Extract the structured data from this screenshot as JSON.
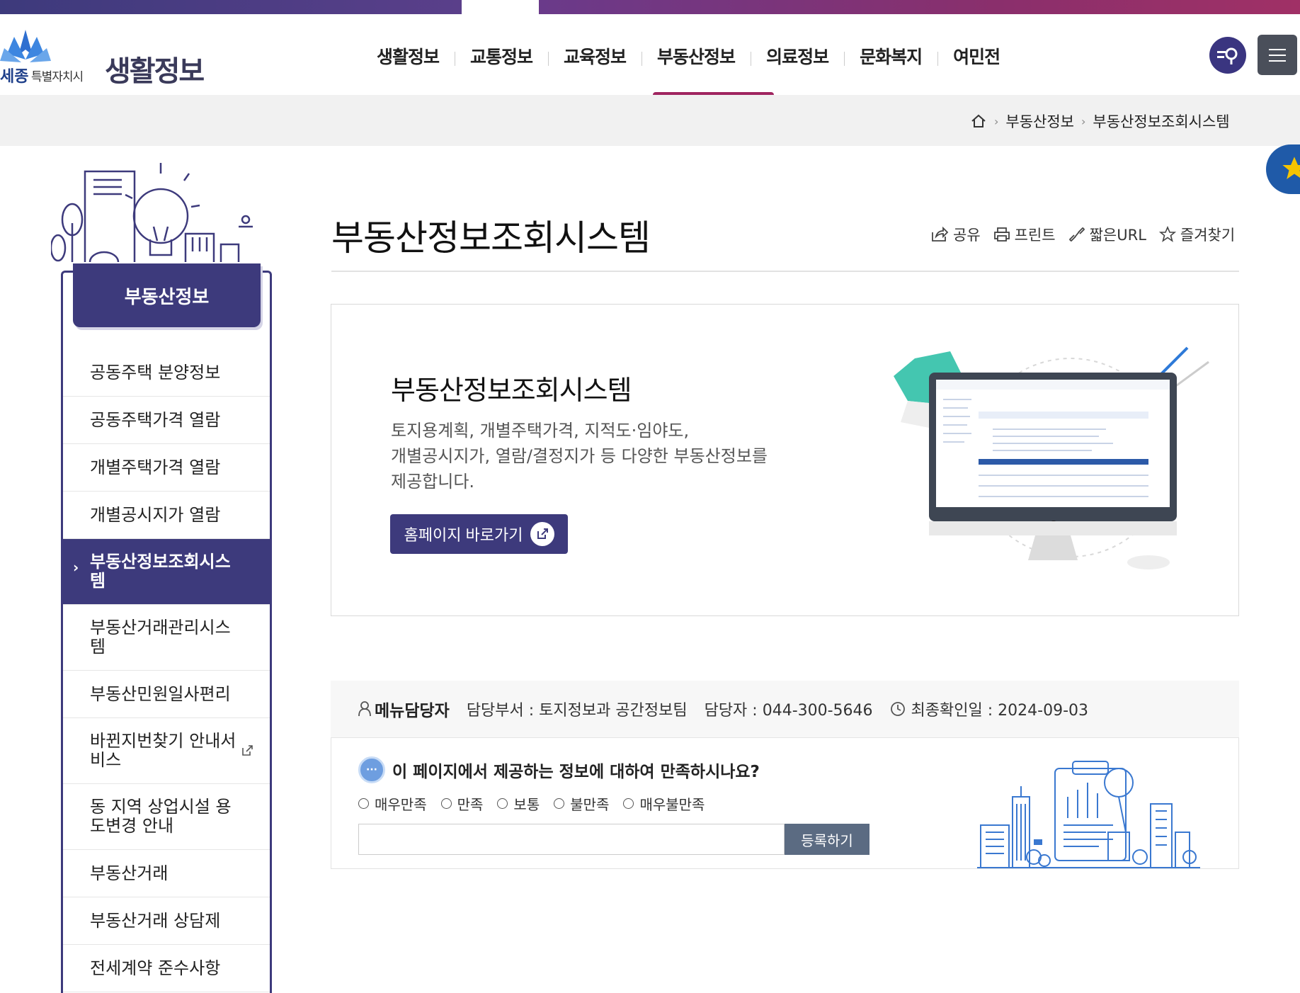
{
  "header": {
    "logo_sejong": "세종",
    "logo_sub": "특별자치시",
    "logo_main": "생활정보",
    "nav": [
      "생활정보",
      "교통정보",
      "교육정보",
      "부동산정보",
      "의료정보",
      "문화복지",
      "여민전"
    ],
    "active_nav": "부동산정보",
    "colors": {
      "primary": "#3d3a7c",
      "accent": "#a02560"
    }
  },
  "breadcrumb": {
    "home_icon": "home-icon",
    "items": [
      "부동산정보",
      "부동산정보조회시스템"
    ]
  },
  "sidebar": {
    "title": "부동산정보",
    "items": [
      {
        "label": "공동주택 분양정보"
      },
      {
        "label": "공동주택가격 열람"
      },
      {
        "label": "개별주택가격 열람"
      },
      {
        "label": "개별공시지가 열람"
      },
      {
        "label": "부동산정보조회시스템",
        "active": true
      },
      {
        "label": "부동산거래관리시스템"
      },
      {
        "label": "부동산민원일사편리"
      },
      {
        "label": "바뀐지번찾기 안내서비스",
        "external": true
      },
      {
        "label": "동 지역 상업시설 용도변경 안내"
      },
      {
        "label": "부동산거래"
      },
      {
        "label": "부동산거래 상담제"
      },
      {
        "label": "전세계약 준수사항"
      }
    ]
  },
  "main": {
    "title": "부동산정보조회시스템",
    "tools": {
      "share": "공유",
      "print": "프린트",
      "short_url": "짧은URL",
      "favorite": "즐겨찾기"
    },
    "card": {
      "title": "부동산정보조회시스템",
      "desc_lines": [
        "토지용계획, 개별주택가격, 지적도·임야도,",
        "개별공시지가, 열람/결정지가 등 다양한 부동산정보를",
        "제공합니다."
      ],
      "button": "홈페이지 바로가기"
    }
  },
  "info": {
    "manager_label": "메뉴담당자",
    "dept": "담당부서 : 토지정보과 공간정보팀",
    "contact": "담당자 : 044-300-5646",
    "date": "최종확인일 : 2024-09-03"
  },
  "survey": {
    "question": "이 페이지에서 제공하는 정보에 대하여 만족하시나요?",
    "bubble": "···",
    "options": [
      "매우만족",
      "만족",
      "보통",
      "불만족",
      "매우불만족"
    ],
    "submit": "등록하기"
  }
}
